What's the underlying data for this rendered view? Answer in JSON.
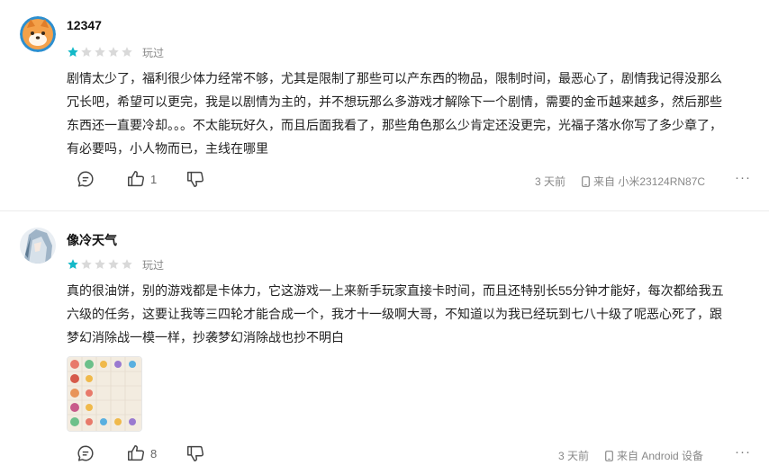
{
  "reviews": [
    {
      "username": "12347",
      "rating": 1,
      "max_rating": 5,
      "status": "玩过",
      "text": "剧情太少了，福利很少体力经常不够，尤其是限制了那些可以产东西的物品，限制时间，最恶心了，剧情我记得没那么冗长吧，希望可以更完，我是以剧情为主的，并不想玩那么多游戏才解除下一个剧情，需要的金币越来越多，然后那些东西还一直要冷却。。。不太能玩好久，而且后面我看了，那些角色那么少肯定还没更完，光福子落水你写了多少章了，有必要吗，小人物而已，主线在哪里",
      "likes": "1",
      "time": "3 天前",
      "device": "来自 小米23124RN87C",
      "more": "···"
    },
    {
      "username": "像冷天气",
      "rating": 1,
      "max_rating": 5,
      "status": "玩过",
      "text": "真的很油饼，别的游戏都是卡体力，它这游戏一上来新手玩家直接卡时间，而且还特别长55分钟才能好，每次都给我五六级的任务，这要让我等三四轮才能合成一个，我才十一级啊大哥，不知道以为我已经玩到七八十级了呢恶心死了，跟梦幻消除战一模一样，抄袭梦幻消除战也抄不明白",
      "likes": "8",
      "time": "3 天前",
      "device": "来自 Android 设备",
      "more": "···"
    }
  ],
  "colors": {
    "star_on": "#14b9c8",
    "star_off": "#d9d9d9",
    "divider": "#ececec"
  },
  "icons": [
    "comment-icon",
    "thumbs-up-icon",
    "thumbs-down-icon",
    "phone-icon",
    "more-icon"
  ]
}
